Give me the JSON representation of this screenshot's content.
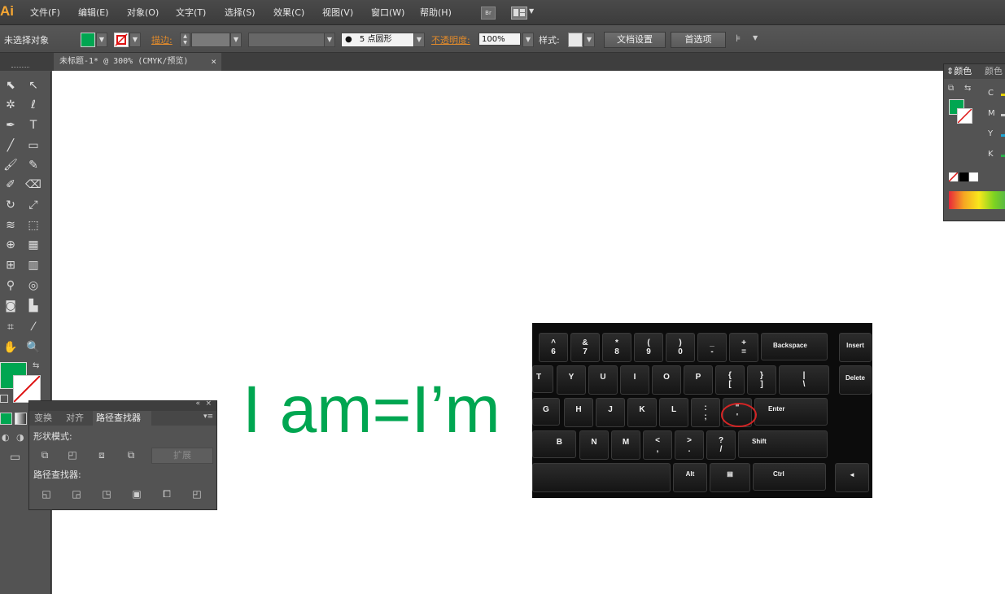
{
  "app": {
    "logo": "Ai"
  },
  "menu": [
    "文件(F)",
    "编辑(E)",
    "对象(O)",
    "文字(T)",
    "选择(S)",
    "效果(C)",
    "视图(V)",
    "窗口(W)",
    "帮助(H)"
  ],
  "menu_icons": {
    "bridge": "Br",
    "arrange": "arrange-documents-icon"
  },
  "control": {
    "selection_status": "未选择对象",
    "fill_color": "#00a651",
    "stroke_label": "描边:",
    "brush_label": "5 点圆形",
    "opacity_label": "不透明度:",
    "opacity_value": "100%",
    "style_label": "样式:",
    "doc_setup": "文档设置",
    "preferences": "首选项"
  },
  "document_tab": {
    "title": "未标题-1* @ 300% (CMYK/预览)",
    "close": "×"
  },
  "canvas": {
    "text": "I am=I’m",
    "text_color": "#00a651"
  },
  "keyboard": {
    "row1": [
      [
        "^",
        "6"
      ],
      [
        "&",
        "7"
      ],
      [
        "*",
        "8"
      ],
      [
        "(",
        "9"
      ],
      [
        ")",
        "0"
      ],
      [
        "_",
        "-"
      ],
      [
        "+",
        "="
      ]
    ],
    "backspace": "Backspace",
    "insert": "Insert",
    "row2": [
      "T",
      "Y",
      "U",
      "I",
      "O",
      "P"
    ],
    "row2_sym": [
      [
        "{",
        "["
      ],
      [
        "}",
        "]"
      ],
      [
        "|",
        "\\"
      ]
    ],
    "delete": "Delete",
    "row3": [
      "G",
      "H",
      "J",
      "K",
      "L"
    ],
    "row3_sym": [
      [
        ":",
        ";"
      ],
      [
        "\"",
        "'"
      ]
    ],
    "enter": "Enter",
    "row4": [
      "B",
      "N",
      "M"
    ],
    "row4_sym": [
      [
        "<",
        ","
      ],
      [
        ">",
        "."
      ],
      [
        "?",
        "/"
      ]
    ],
    "shift": "Shift",
    "alt": "Alt",
    "ctrl": "Ctrl",
    "arrow_left": "◄"
  },
  "pathfinder_panel": {
    "tabs": [
      "变换",
      "对齐",
      "路径查找器"
    ],
    "shape_modes_label": "形状模式:",
    "expand": "扩展",
    "pathfinders_label": "路径查找器:"
  },
  "color_panel": {
    "tabs": [
      "颜色",
      "颜色"
    ],
    "channels": [
      "C",
      "M",
      "Y",
      "K"
    ]
  }
}
